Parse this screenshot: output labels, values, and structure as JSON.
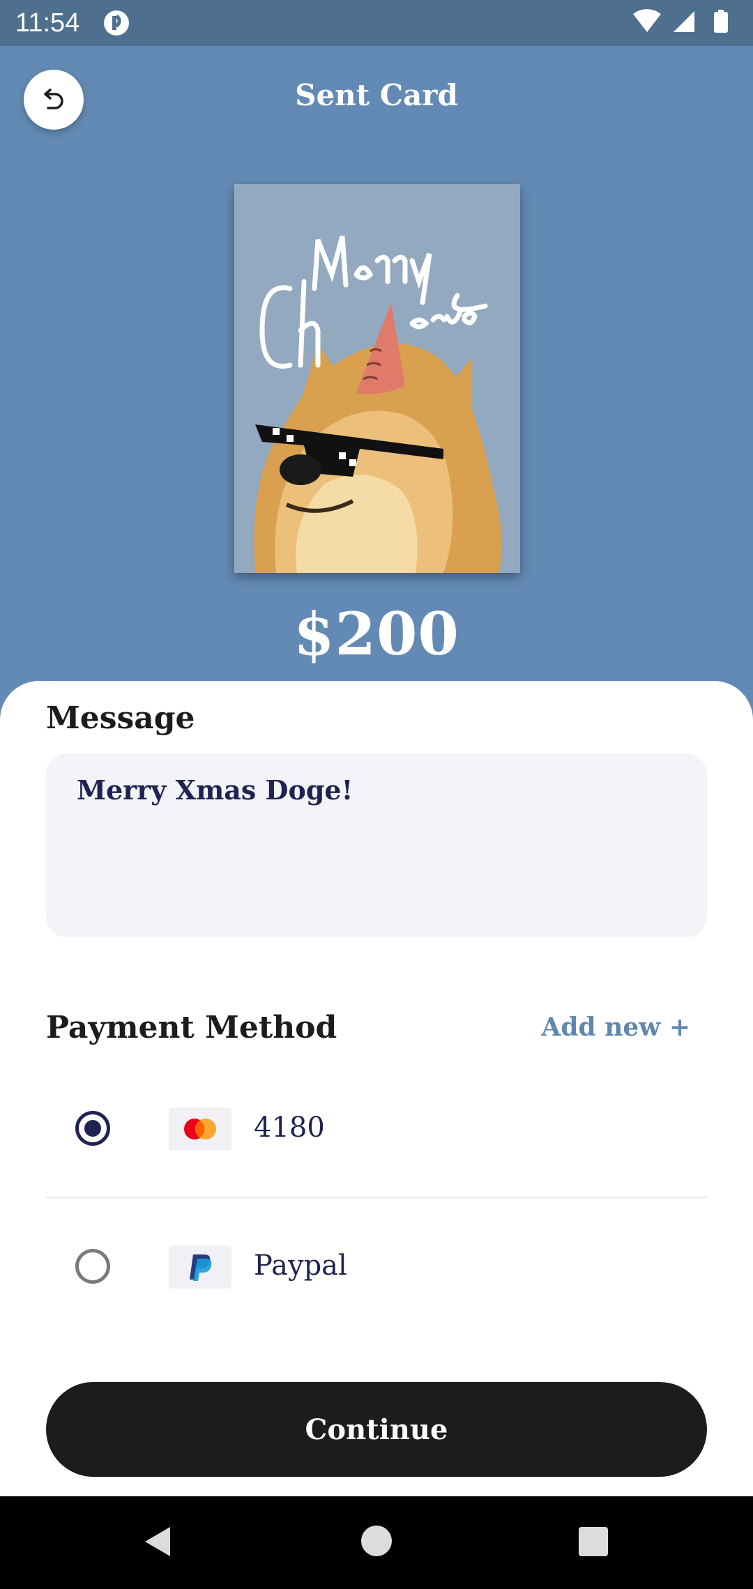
{
  "status_bar": {
    "time": "11:54",
    "icons": [
      "app-notification-icon",
      "wifi-icon",
      "signal-icon",
      "battery-icon"
    ]
  },
  "header": {
    "title": "Sent Card",
    "back_icon": "undo-arrow-icon"
  },
  "card": {
    "image_text": "Merry Christmas",
    "background_color": "#93a9c0"
  },
  "price": "$200",
  "message": {
    "heading": "Message",
    "value": "Merry Xmas Doge!"
  },
  "payment": {
    "heading": "Payment Method",
    "add_new": "Add new +",
    "methods": [
      {
        "label": "4180",
        "icon": "mastercard-icon",
        "selected": true
      },
      {
        "label": "Paypal",
        "icon": "paypal-icon",
        "selected": false
      }
    ]
  },
  "continue_label": "Continue",
  "colors": {
    "background": "#638ab4",
    "status_bar": "#4f6f8f",
    "accent": "#5f87b1",
    "text_dark": "#1f2352",
    "button": "#1c1c1c"
  }
}
